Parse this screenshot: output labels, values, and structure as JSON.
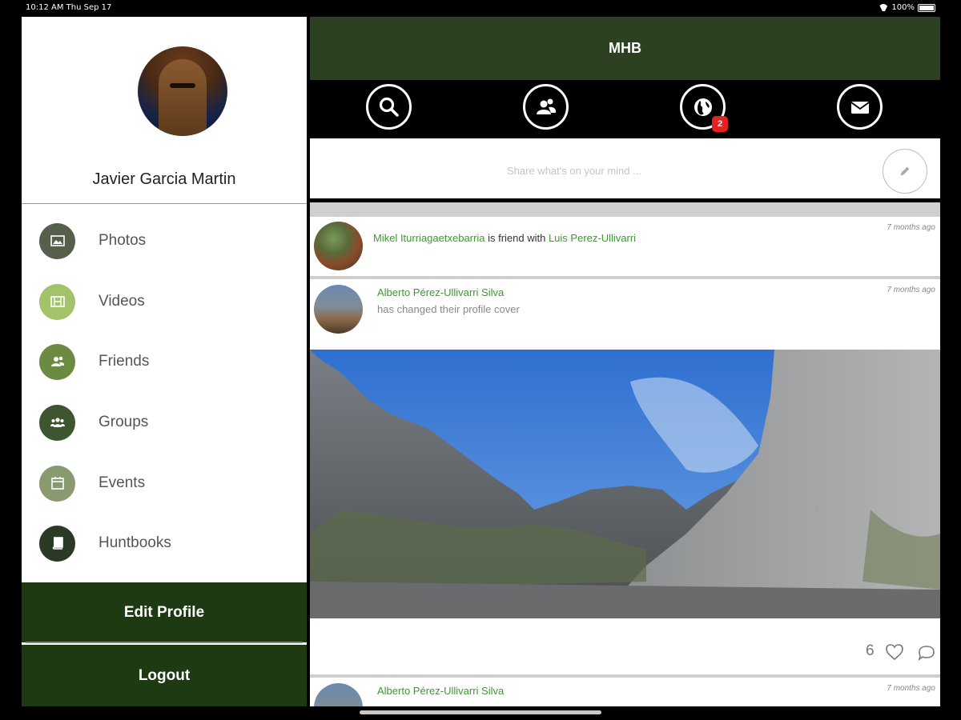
{
  "status_bar": {
    "time": "10:12 AM  Thu Sep 17",
    "battery": "100%"
  },
  "sidebar": {
    "username": "Javier Garcia Martin",
    "menu": [
      {
        "label": "Photos",
        "icon": "image-icon",
        "color": "#565f4c"
      },
      {
        "label": "Videos",
        "icon": "film-icon",
        "color": "#a3c36b"
      },
      {
        "label": "Friends",
        "icon": "users-icon",
        "color": "#6b8a42"
      },
      {
        "label": "Groups",
        "icon": "group-icon",
        "color": "#3e5530"
      },
      {
        "label": "Events",
        "icon": "calendar-icon",
        "color": "#8a9a70"
      },
      {
        "label": "Huntbooks",
        "icon": "book-icon",
        "color": "#2b3a25"
      }
    ],
    "edit_profile": "Edit Profile",
    "logout": "Logout"
  },
  "header": {
    "title": "MHB"
  },
  "toolbar": {
    "notifications_badge": "2",
    "icons": [
      "search-icon",
      "friends-icon",
      "globe-icon",
      "mail-icon"
    ]
  },
  "composer": {
    "placeholder": "Share what's on your mind ..."
  },
  "feed": [
    {
      "actor": "Mikel Iturriagaetxebarria",
      "verb": "is friend with",
      "target": "Luis Perez-Ullivarri",
      "time": "7 months ago"
    },
    {
      "actor": "Alberto Pérez-Ullivarri Silva",
      "description": "has changed their profile cover",
      "time": "7 months ago",
      "likes": "6"
    },
    {
      "actor": "Alberto Pérez-Ullivarri Silva",
      "time": "7 months ago"
    }
  ],
  "colors": {
    "header_green": "#2c4122",
    "button_green": "#1d3a12",
    "link_green": "#3a9a2c",
    "badge_red": "#e32322"
  }
}
